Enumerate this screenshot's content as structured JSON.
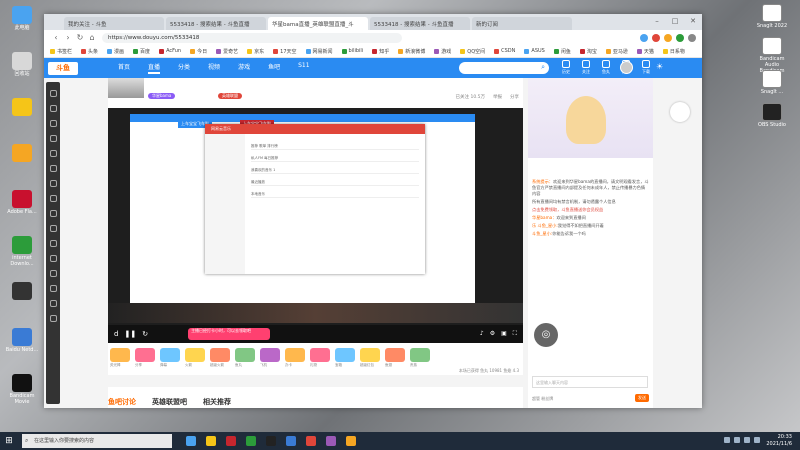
{
  "desktop_left": [
    {
      "label": "此电脑",
      "color": "#4aa3f0"
    },
    {
      "label": "回收站",
      "color": "#d8d8d8"
    },
    {
      "label": "",
      "color": "#f5c518"
    },
    {
      "label": "",
      "color": "#f5a623"
    },
    {
      "label": "Adobe Fla...",
      "color": "#c8102e"
    },
    {
      "label": "internet Downlo...",
      "color": "#2c9c3a"
    },
    {
      "label": "",
      "color": "#333"
    },
    {
      "label": "Baidu Netd...",
      "color": "#3a7bd5"
    },
    {
      "label": "Bandicam Movie",
      "color": "#111"
    }
  ],
  "desktop_right": [
    {
      "label": "SnagIt 2022",
      "color": "#ffffff"
    },
    {
      "label": "Bandicam Audio Bandicam",
      "color": "#ffffff"
    },
    {
      "label": "SnagIt ...",
      "color": "#ffffff"
    },
    {
      "label": "OBS Studio",
      "color": "#222222"
    }
  ],
  "browser": {
    "tabs": [
      {
        "label": "我的关注 - 斗鱼",
        "active": false
      },
      {
        "label": "5533418 - 搜索结果 - 斗鱼直播",
        "active": false
      },
      {
        "label": "华星bama直播_英雄联盟直播_斗",
        "active": true
      },
      {
        "label": "5533418 - 搜索结果 - 斗鱼直播",
        "active": false
      },
      {
        "label": "新的订阅",
        "active": false
      }
    ],
    "url": "https://www.douyu.com/5533418",
    "bookmarks": [
      "书签栏",
      "头条",
      "漫画",
      "百度",
      "AcFun",
      "今日",
      "爱奇艺",
      "京东",
      "17天空",
      "网易新闻",
      "bilibili",
      "知乎",
      "新浪微博",
      "游戏",
      "QQ空间",
      "CSDN",
      "ASUS",
      "闲鱼",
      "淘宝",
      "亚马逊",
      "天猫",
      "日系物"
    ]
  },
  "site": {
    "logo": "斗鱼",
    "nav": [
      "首页",
      "直播",
      "分类",
      "视频",
      "游戏",
      "鱼吧",
      "S11"
    ],
    "top_icons": [
      "历史",
      "关注",
      "鱼丸",
      "开播",
      "下载"
    ]
  },
  "room": {
    "tags": [
      "华星bama",
      "英雄联盟"
    ],
    "head_right": [
      "已关注 10.5万",
      "举报",
      "分享"
    ],
    "overlay_top": "上车宝宝飞车啦",
    "overlay_top2": "上车宝宝飞车啦",
    "netease_title": "网易云音乐",
    "song_rows": [
      "推荐 歌单 排行榜",
      "私人FM 每日推荐",
      "我喜欢的音乐 1",
      "最近播放",
      "本地音乐"
    ],
    "pink_banner": "主播已经打卡小时，可以去领取吧",
    "gifts": [
      "荧光棒",
      "分享",
      "弹幕",
      "火箭",
      "超级火箭",
      "鱼丸",
      "飞机",
      "办卡",
      "礼物",
      "宝箱",
      "超级红包",
      "鱼翅",
      "贵族"
    ],
    "stats": "本场已获得 鱼丸 10981 鱼翅 4.3",
    "under_tabs": [
      "鱼吧讨论",
      "英雄联盟吧",
      "相关推荐"
    ]
  },
  "sidebar": {
    "messages": [
      {
        "name": "系统提示：",
        "text": "欢迎来到华星bama的直播间，请文明观看发言，斗鱼官方严禁直播间内部提及任何未成年人，禁止传播暴力色情内容"
      },
      {
        "name": "",
        "text": "所有直播间均有禁言机制，请勿透露个人信息"
      },
      {
        "name": "",
        "text": "点击免费领取，斗鱼直播送你会员权益"
      },
      {
        "name": "华星bama：",
        "text": "欢迎来到直播间"
      },
      {
        "name": "乐 斗鱼_星小:",
        "text": "我觉得不如把直播间开着"
      },
      {
        "name": "斗鱼_星小:",
        "text": "你能告诉我一个吗"
      }
    ],
    "chat_placeholder": "这里输入聊天内容",
    "send_label": "发送",
    "bottom": "超管 粉丝牌"
  },
  "taskbar": {
    "search_placeholder": "在这里输入你要搜索的内容",
    "time": "20:33",
    "date": "2021/11/6"
  }
}
